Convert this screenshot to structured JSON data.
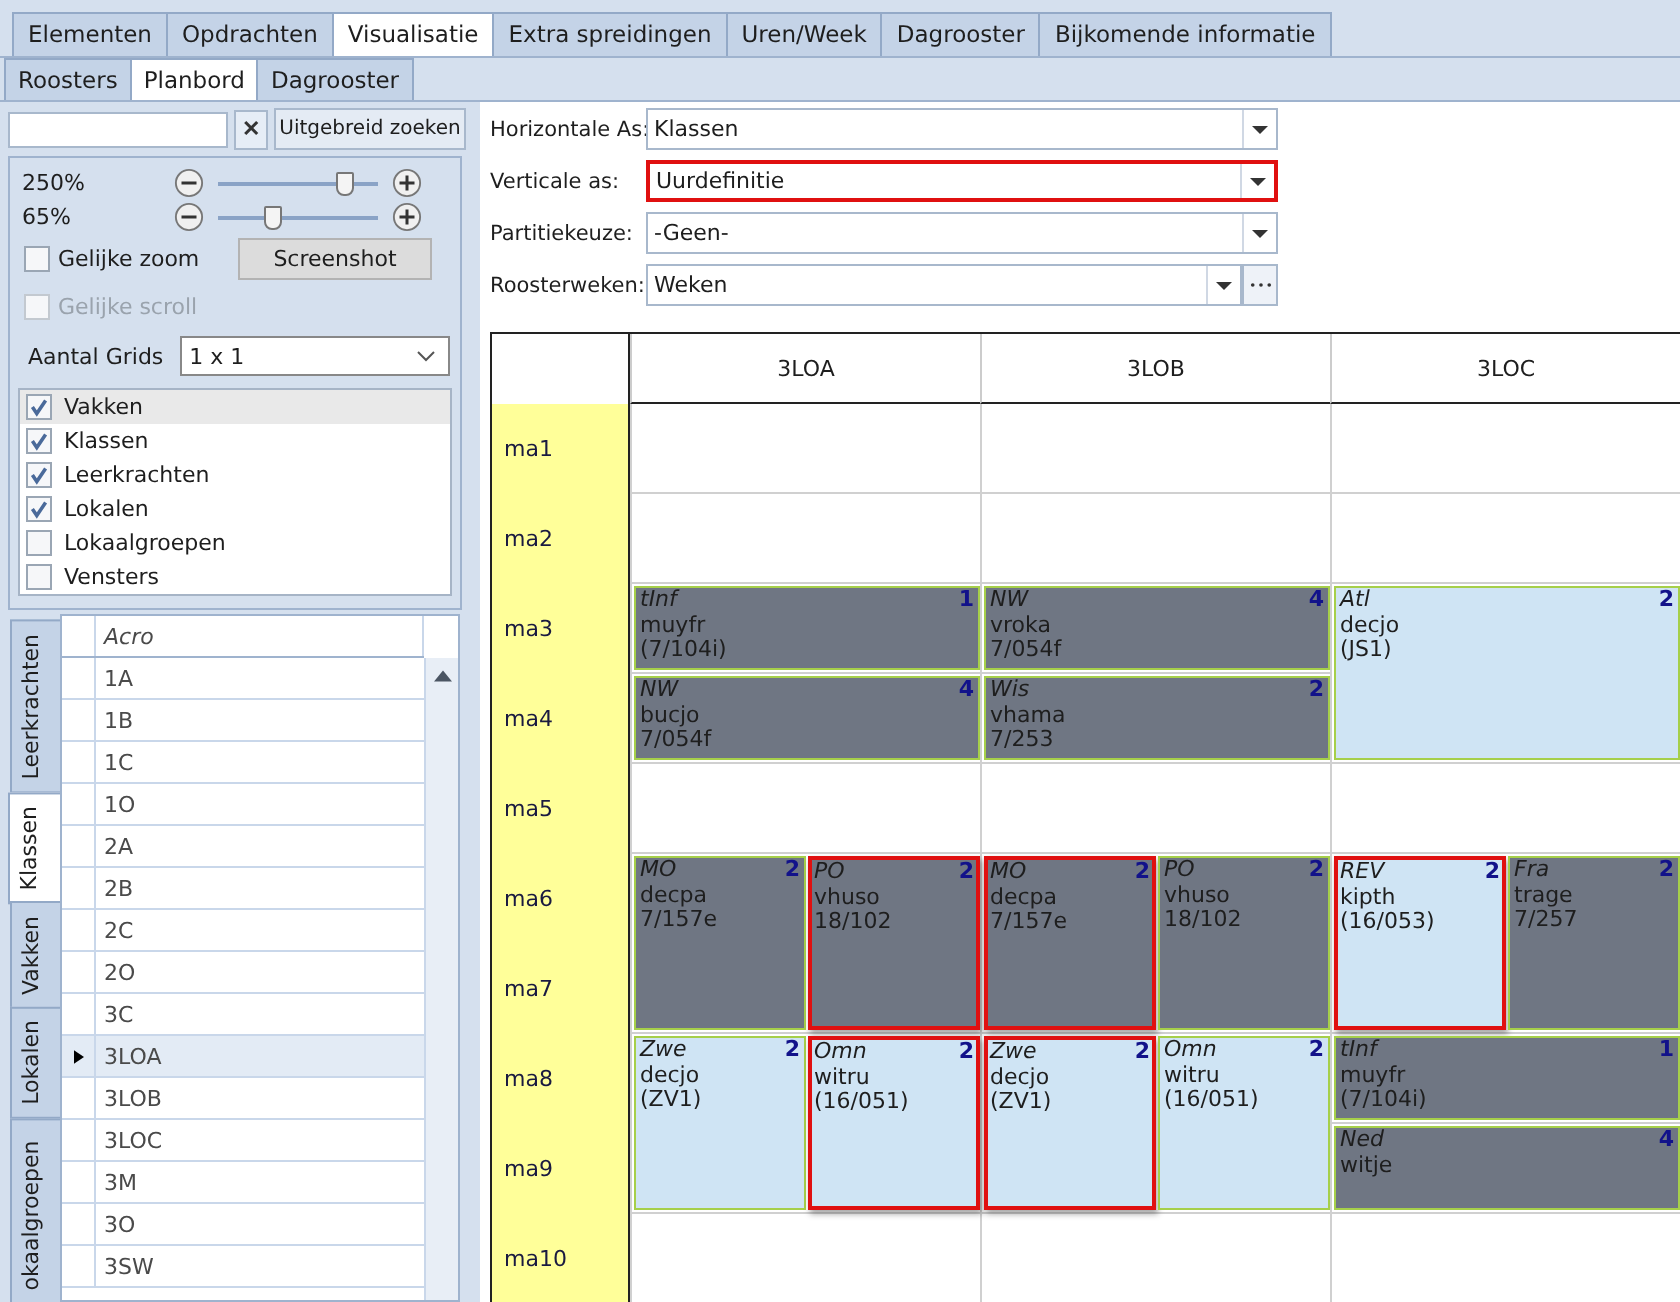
{
  "top_tabs": [
    {
      "label": "Elementen",
      "selected": false
    },
    {
      "label": "Opdrachten",
      "selected": false
    },
    {
      "label": "Visualisatie",
      "selected": true
    },
    {
      "label": "Extra spreidingen",
      "selected": false
    },
    {
      "label": "Uren/Week",
      "selected": false
    },
    {
      "label": "Dagrooster",
      "selected": false
    },
    {
      "label": "Bijkomende informatie",
      "selected": false
    }
  ],
  "sub_tabs": [
    {
      "label": "Roosters",
      "selected": false
    },
    {
      "label": "Planbord",
      "selected": true
    },
    {
      "label": "Dagrooster",
      "selected": false
    }
  ],
  "search": {
    "clear": "✕",
    "button": "Uitgebreid zoeken"
  },
  "zoom": [
    {
      "reading": "250%",
      "level": 0.8
    },
    {
      "reading": "65%",
      "level": 0.35
    }
  ],
  "options": [
    {
      "label": "Gelijke zoom",
      "checked": false,
      "disabled": false
    },
    {
      "label": "Gelijke scroll",
      "checked": false,
      "disabled": true
    }
  ],
  "screenshot_button": "Screenshot",
  "grids": {
    "label": "Aantal Grids",
    "value": "1 x 1"
  },
  "element_list": [
    {
      "label": "Vakken",
      "checked": true,
      "selected": true
    },
    {
      "label": "Klassen",
      "checked": true,
      "selected": false
    },
    {
      "label": "Leerkrachten",
      "checked": true,
      "selected": false
    },
    {
      "label": "Lokalen",
      "checked": true,
      "selected": false
    },
    {
      "label": "Lokaalgroepen",
      "checked": false,
      "selected": false
    },
    {
      "label": "Vensters",
      "checked": false,
      "selected": false
    }
  ],
  "side_tabs": [
    {
      "label": "Leerkrachten",
      "selected": false
    },
    {
      "label": "Klassen",
      "selected": true
    },
    {
      "label": "Vakken",
      "selected": false
    },
    {
      "label": "Lokalen",
      "selected": false
    },
    {
      "label": "okaalgroepen",
      "selected": false
    }
  ],
  "class_table": {
    "column": "Acro",
    "rows": [
      {
        "label": "1A",
        "current": false
      },
      {
        "label": "1B",
        "current": false
      },
      {
        "label": "1C",
        "current": false
      },
      {
        "label": "1O",
        "current": false
      },
      {
        "label": "2A",
        "current": false
      },
      {
        "label": "2B",
        "current": false
      },
      {
        "label": "2C",
        "current": false
      },
      {
        "label": "2O",
        "current": false
      },
      {
        "label": "3C",
        "current": false
      },
      {
        "label": "3LOA",
        "current": true
      },
      {
        "label": "3LOB",
        "current": false
      },
      {
        "label": "3LOC",
        "current": false
      },
      {
        "label": "3M",
        "current": false
      },
      {
        "label": "3O",
        "current": false
      },
      {
        "label": "3SW",
        "current": false
      }
    ]
  },
  "fields": [
    {
      "label": "Horizontale As:",
      "value": "Klassen",
      "kind": "combo",
      "highlighted": false
    },
    {
      "label": "Verticale as:",
      "value": "Uurdefinitie",
      "kind": "combo",
      "highlighted": true
    },
    {
      "label": "Partitiekeuze:",
      "value": "-Geen-",
      "kind": "combo",
      "highlighted": false
    },
    {
      "label": "Roosterweken:",
      "value": "Weken",
      "kind": "combo-browse",
      "highlighted": false
    }
  ],
  "board": {
    "periods": [
      "ma1",
      "ma2",
      "ma3",
      "ma4",
      "ma5",
      "ma6",
      "ma7",
      "ma8",
      "ma9",
      "ma10"
    ],
    "classes": [
      {
        "name": "3LOA",
        "slots": [
          {
            "kind": "single"
          },
          {
            "kind": "single"
          },
          {
            "kind": "single",
            "lessons": [
              {
                "subject": "tInf",
                "count": "1",
                "teacher": "muyfr",
                "room": "(7/104i)",
                "kind": "dark",
                "conflict": false
              }
            ]
          },
          {
            "kind": "single",
            "lessons": [
              {
                "subject": "NW",
                "count": "4",
                "teacher": "bucjo",
                "room": "7/054f",
                "kind": "dark",
                "conflict": false
              }
            ]
          },
          {
            "kind": "single"
          },
          {
            "kind": "double",
            "lessons": [
              {
                "subject": "MO",
                "count": "2",
                "teacher": "decpa",
                "room": "7/157e",
                "kind": "dark",
                "conflict": false
              },
              {
                "subject": "PO",
                "count": "2",
                "teacher": "vhuso",
                "room": "18/102",
                "kind": "dark",
                "conflict": true
              }
            ]
          },
          {
            "kind": "double",
            "lessons": [
              {
                "subject": "Zwe",
                "count": "2",
                "teacher": "decjo",
                "room": "(ZV1)",
                "kind": "light",
                "conflict": false
              },
              {
                "subject": "Omn",
                "count": "2",
                "teacher": "witru",
                "room": "(16/051)",
                "kind": "light",
                "conflict": true
              }
            ]
          },
          {
            "kind": "single"
          }
        ]
      },
      {
        "name": "3LOB",
        "slots": [
          {
            "kind": "single"
          },
          {
            "kind": "single"
          },
          {
            "kind": "single",
            "lessons": [
              {
                "subject": "NW",
                "count": "4",
                "teacher": "vroka",
                "room": "7/054f",
                "kind": "dark",
                "conflict": false
              }
            ]
          },
          {
            "kind": "single",
            "lessons": [
              {
                "subject": "Wis",
                "count": "2",
                "teacher": "vhama",
                "room": "7/253",
                "kind": "dark",
                "conflict": false
              }
            ]
          },
          {
            "kind": "single"
          },
          {
            "kind": "double",
            "lessons": [
              {
                "subject": "MO",
                "count": "2",
                "teacher": "decpa",
                "room": "7/157e",
                "kind": "dark",
                "conflict": true
              },
              {
                "subject": "PO",
                "count": "2",
                "teacher": "vhuso",
                "room": "18/102",
                "kind": "dark",
                "conflict": false
              }
            ]
          },
          {
            "kind": "double",
            "lessons": [
              {
                "subject": "Zwe",
                "count": "2",
                "teacher": "decjo",
                "room": "(ZV1)",
                "kind": "light",
                "conflict": true
              },
              {
                "subject": "Omn",
                "count": "2",
                "teacher": "witru",
                "room": "(16/051)",
                "kind": "light",
                "conflict": false
              }
            ]
          },
          {
            "kind": "single"
          }
        ]
      },
      {
        "name": "3LOC",
        "slots": [
          {
            "kind": "single"
          },
          {
            "kind": "single"
          },
          {
            "kind": "double",
            "lessons": [
              {
                "subject": "Atl",
                "count": "2",
                "teacher": "decjo",
                "room": "(JS1)",
                "kind": "light",
                "conflict": false
              }
            ]
          },
          {
            "kind": "single"
          },
          {
            "kind": "double",
            "lessons": [
              {
                "subject": "REV",
                "count": "2",
                "teacher": "kipth",
                "room": "(16/053)",
                "kind": "light",
                "conflict": true
              },
              {
                "subject": "Fra",
                "count": "2",
                "teacher": "trage",
                "room": "7/257",
                "kind": "dark",
                "conflict": false
              }
            ]
          },
          {
            "kind": "single",
            "lessons": [
              {
                "subject": "tInf",
                "count": "1",
                "teacher": "muyfr",
                "room": "(7/104i)",
                "kind": "dark",
                "conflict": false
              }
            ]
          },
          {
            "kind": "single",
            "lessons": [
              {
                "subject": "Ned",
                "count": "4",
                "teacher": "witje",
                "kind": "dark",
                "conflict": false
              }
            ]
          },
          {
            "kind": "single"
          }
        ]
      }
    ]
  }
}
